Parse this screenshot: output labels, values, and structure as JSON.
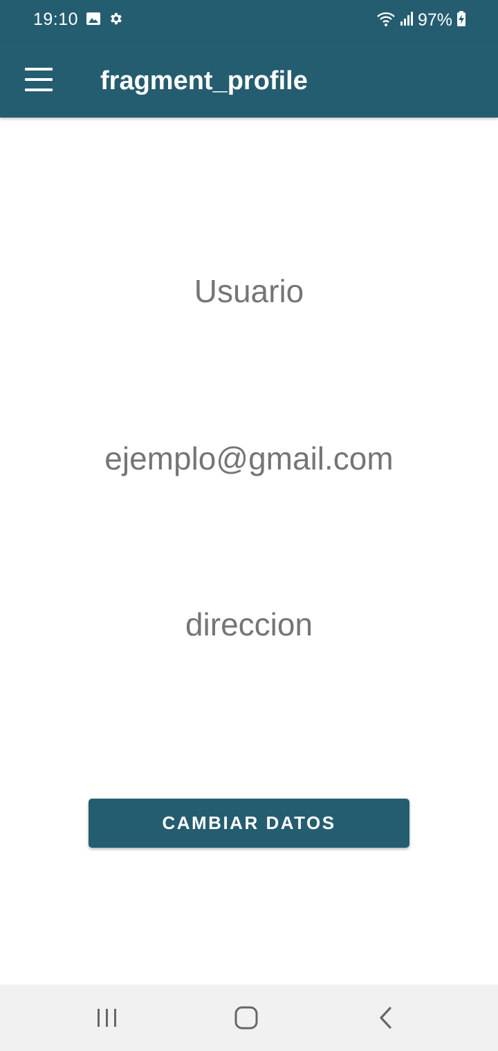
{
  "status_bar": {
    "time": "19:10",
    "battery": "97%",
    "icons": [
      "image-icon",
      "gear-icon",
      "wifi-icon",
      "signal-icon",
      "battery-charging-icon"
    ]
  },
  "app_bar": {
    "title": "fragment_profile",
    "menu_icon": "hamburger-menu-icon"
  },
  "profile": {
    "user": "Usuario",
    "email": "ejemplo@gmail.com",
    "address": "direccion"
  },
  "actions": {
    "change_data_label": "CAMBIAR DATOS"
  },
  "nav_bar": {
    "icons": [
      "recents-icon",
      "home-icon",
      "back-icon"
    ]
  },
  "colors": {
    "primary": "#255d70",
    "text_secondary": "#757575",
    "nav_background": "#f1f1f1"
  }
}
